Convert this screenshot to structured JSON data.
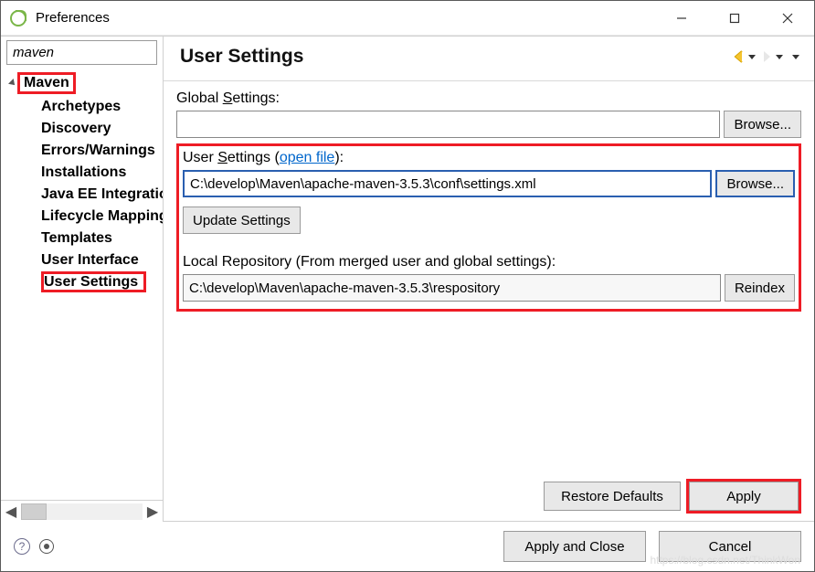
{
  "window": {
    "title": "Preferences"
  },
  "search": {
    "value": "maven"
  },
  "tree": {
    "parent": "Maven",
    "children": [
      "Archetypes",
      "Discovery",
      "Errors/Warnings",
      "Installations",
      "Java EE Integration",
      "Lifecycle Mappings",
      "Templates",
      "User Interface",
      "User Settings"
    ],
    "selected": "User Settings"
  },
  "page": {
    "heading": "User Settings",
    "globalLabel": "Global Settings:",
    "globalValue": "",
    "browse": "Browse...",
    "userLabelPrefix": "User Settings (",
    "openFile": "open file",
    "userLabelSuffix": "):",
    "userValue": "C:\\develop\\Maven\\apache-maven-3.5.3\\conf\\settings.xml",
    "updateBtn": "Update Settings",
    "localRepoLabel": "Local Repository (From merged user and global settings):",
    "localRepoValue": "C:\\develop\\Maven\\apache-maven-3.5.3\\respository",
    "reindex": "Reindex"
  },
  "buttons": {
    "restore": "Restore Defaults",
    "apply": "Apply",
    "applyClose": "Apply and Close",
    "cancel": "Cancel"
  },
  "watermark": "https://blog.csdn.net/ThinkWon"
}
